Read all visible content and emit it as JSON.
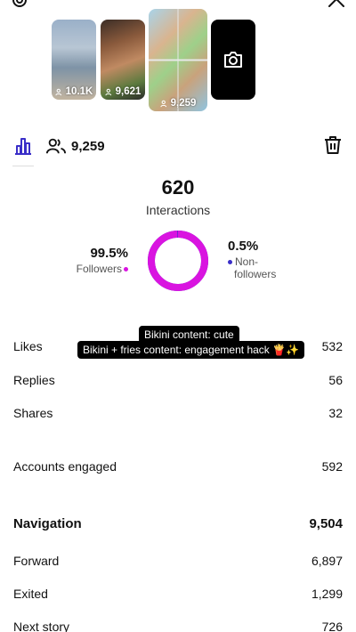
{
  "stories": [
    {
      "views": "10.1K"
    },
    {
      "views": "9,621"
    },
    {
      "views": "9,259"
    }
  ],
  "header": {
    "followers_count": "9,259"
  },
  "summary": {
    "total": "620",
    "label": "Interactions",
    "followers_pct": "99.5%",
    "followers_label": "Followers",
    "nonfollowers_pct": "0.5%",
    "nonfollowers_label_line1": "Non-",
    "nonfollowers_label_line2": "followers",
    "followers_fraction": 0.995,
    "colors": {
      "followers": "#d914e0",
      "nonfollowers": "#3a2ec8"
    }
  },
  "overlay": {
    "sticker1": "Bikini content: cute",
    "sticker2": "Bikini + fries content: engagement hack 🍟✨"
  },
  "metrics": {
    "likes_label": "Likes",
    "likes_value": "532",
    "replies_label": "Replies",
    "replies_value": "56",
    "shares_label": "Shares",
    "shares_value": "32",
    "accounts_label": "Accounts engaged",
    "accounts_value": "592"
  },
  "navigation": {
    "title": "Navigation",
    "total": "9,504",
    "forward_label": "Forward",
    "forward_value": "6,897",
    "exited_label": "Exited",
    "exited_value": "1,299",
    "next_label": "Next story",
    "next_value": "726"
  }
}
